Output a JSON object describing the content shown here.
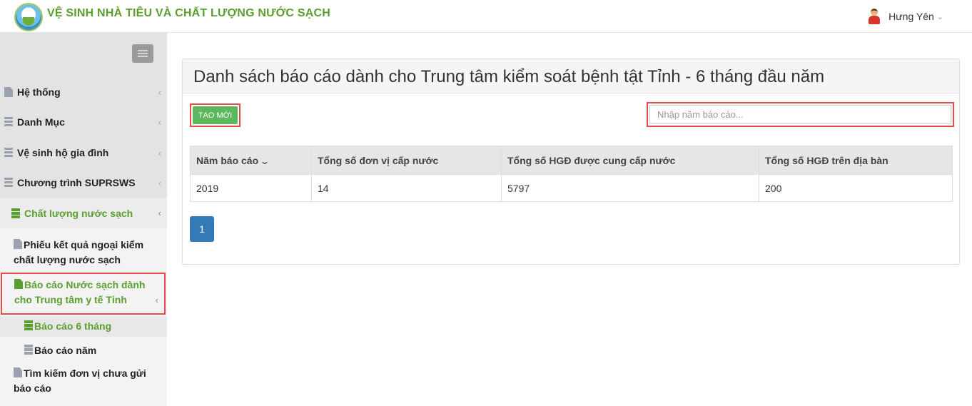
{
  "header": {
    "app_title": "VỆ SINH NHÀ TIÊU VÀ CHẤT LƯỢNG NƯỚC SẠCH",
    "user_name": "Hưng Yên",
    "user_chevron": "⌄"
  },
  "sidebar": {
    "items": [
      {
        "label": "Hệ thống",
        "icon": "file-icon",
        "chevron": "‹"
      },
      {
        "label": "Danh Mục",
        "icon": "list-icon",
        "chevron": "‹"
      },
      {
        "label": "Vệ sinh hộ gia đình",
        "icon": "list-icon",
        "chevron": "‹"
      },
      {
        "label": "Chương trình SUPRSWS",
        "icon": "list-icon",
        "chevron": "‹"
      },
      {
        "label": "Chất lượng nước sạch",
        "icon": "server-icon",
        "chevron": "‹"
      }
    ],
    "sub_items": [
      {
        "label": "Phiếu kết quả ngoại kiểm chất lượng nước sạch"
      },
      {
        "label": "Báo cáo Nước sạch dành cho Trung tâm y tế Tỉnh",
        "chevron": "‹"
      },
      {
        "label": "Báo cáo 6 tháng"
      },
      {
        "label": "Báo cáo năm"
      },
      {
        "label": "Tìm kiếm đơn vị chưa gửi báo cáo"
      }
    ]
  },
  "main": {
    "title": "Danh sách báo cáo dành cho Trung tâm kiểm soát bệnh tật Tỉnh - 6 tháng đầu năm",
    "create_button": "TẠO MỚI",
    "search_placeholder": "Nhập năm báo cáo...",
    "table": {
      "headers": [
        "Năm báo cáo",
        "Tổng số đơn vị cấp nước",
        "Tổng số HGĐ được cung cấp nước",
        "Tổng số HGĐ trên địa bàn"
      ],
      "sort_icon": "⌄",
      "rows": [
        [
          "2019",
          "14",
          "5797",
          "200"
        ]
      ]
    },
    "pagination": {
      "current_page": "1"
    }
  },
  "colors": {
    "brand_green": "#5a9e2f",
    "button_green": "#5cb85c",
    "pagination_blue": "#337ab7",
    "highlight_red": "#e74c4c"
  }
}
